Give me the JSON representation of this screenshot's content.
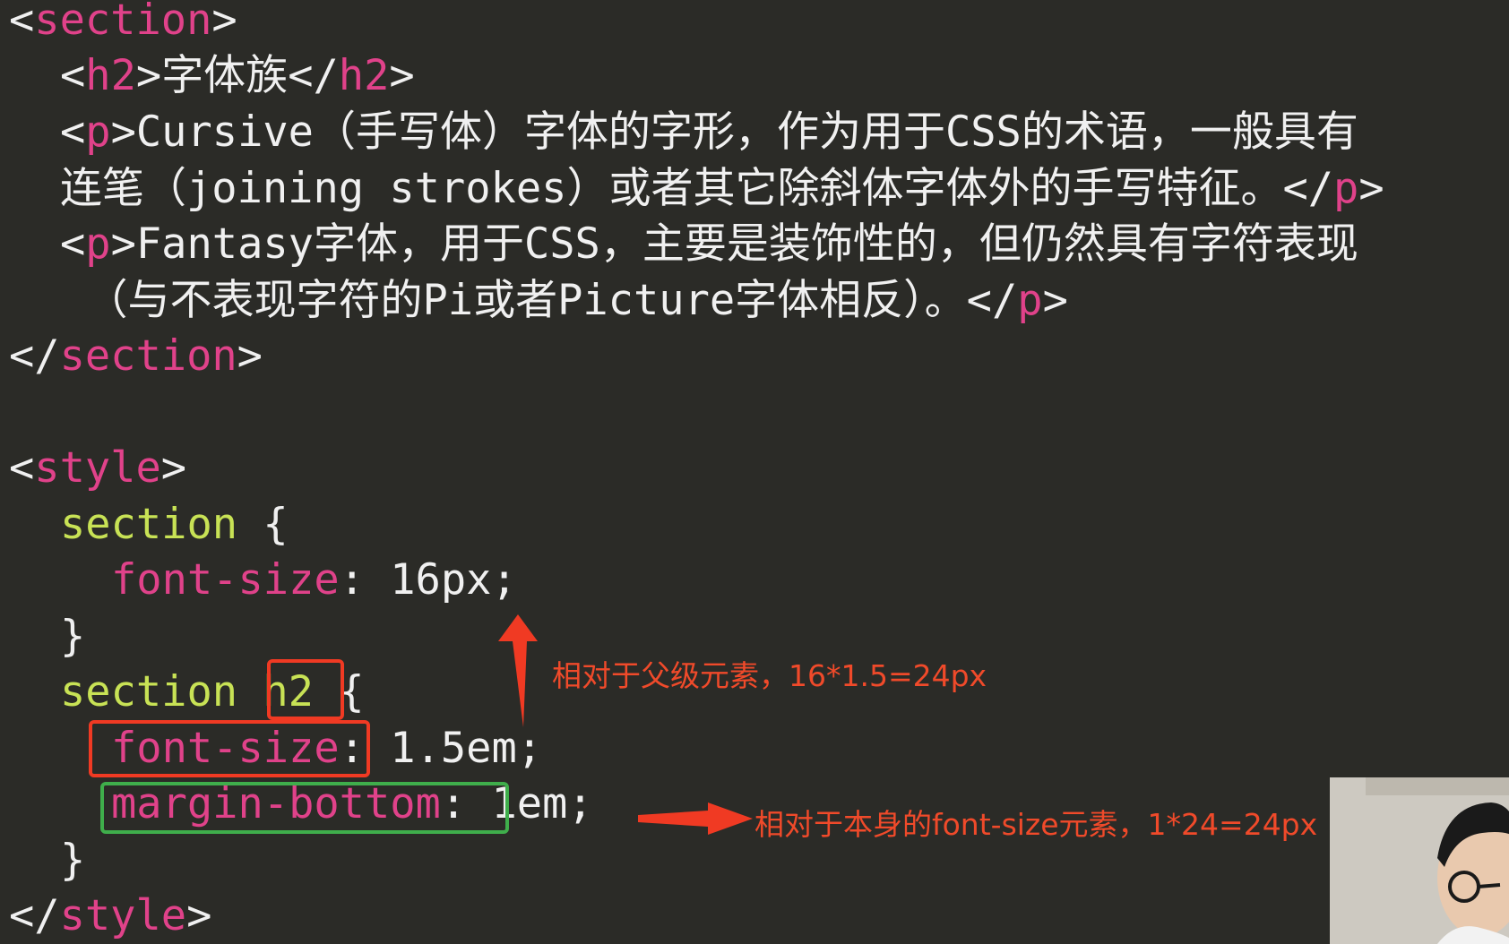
{
  "code_lines": [
    {
      "indent": "",
      "parts": [
        [
          "bracket",
          "<"
        ],
        [
          "tag",
          "section"
        ],
        [
          "bracket",
          ">"
        ]
      ]
    },
    {
      "indent": "  ",
      "parts": [
        [
          "bracket",
          "<"
        ],
        [
          "tag",
          "h2"
        ],
        [
          "bracket",
          ">"
        ],
        [
          "txt",
          "字体族"
        ],
        [
          "bracket",
          "</"
        ],
        [
          "tag",
          "h2"
        ],
        [
          "bracket",
          ">"
        ]
      ]
    },
    {
      "indent": "  ",
      "parts": [
        [
          "bracket",
          "<"
        ],
        [
          "tag",
          "p"
        ],
        [
          "bracket",
          ">"
        ],
        [
          "txt",
          "Cursive（手写体）字体的字形，作为用于CSS的术语，一般具有"
        ]
      ]
    },
    {
      "indent": "  ",
      "parts": [
        [
          "txt",
          "连笔（joining strokes）或者其它除斜体字体外的手写特征。"
        ],
        [
          "bracket",
          "</"
        ],
        [
          "tag",
          "p"
        ],
        [
          "bracket",
          ">"
        ]
      ]
    },
    {
      "indent": "  ",
      "parts": [
        [
          "bracket",
          "<"
        ],
        [
          "tag",
          "p"
        ],
        [
          "bracket",
          ">"
        ],
        [
          "txt",
          "Fantasy字体，用于CSS，主要是装饰性的，但仍然具有字符表现"
        ]
      ]
    },
    {
      "indent": "   ",
      "parts": [
        [
          "txt",
          "（与不表现字符的Pi或者Picture字体相反）。"
        ],
        [
          "bracket",
          "</"
        ],
        [
          "tag",
          "p"
        ],
        [
          "bracket",
          ">"
        ]
      ]
    },
    {
      "indent": "",
      "parts": [
        [
          "bracket",
          "</"
        ],
        [
          "tag",
          "section"
        ],
        [
          "bracket",
          ">"
        ]
      ]
    },
    {
      "indent": "",
      "parts": []
    },
    {
      "indent": "",
      "parts": [
        [
          "bracket",
          "<"
        ],
        [
          "tag",
          "style"
        ],
        [
          "bracket",
          ">"
        ]
      ]
    },
    {
      "indent": "  ",
      "parts": [
        [
          "sel",
          "section"
        ],
        [
          "bracket",
          " {"
        ]
      ]
    },
    {
      "indent": "    ",
      "parts": [
        [
          "prop",
          "font-size"
        ],
        [
          "val",
          ": 16px;"
        ]
      ]
    },
    {
      "indent": "  ",
      "parts": [
        [
          "bracket",
          "}"
        ]
      ]
    },
    {
      "indent": "  ",
      "parts": [
        [
          "sel",
          "section h2"
        ],
        [
          "bracket",
          " {"
        ]
      ]
    },
    {
      "indent": "    ",
      "parts": [
        [
          "prop",
          "font-size"
        ],
        [
          "val",
          ": 1.5em;"
        ]
      ]
    },
    {
      "indent": "    ",
      "parts": [
        [
          "prop",
          "margin-bottom"
        ],
        [
          "val",
          ": 1em;"
        ]
      ]
    },
    {
      "indent": "  ",
      "parts": [
        [
          "bracket",
          "}"
        ]
      ]
    },
    {
      "indent": "",
      "parts": [
        [
          "bracket",
          "</"
        ],
        [
          "tag",
          "style"
        ],
        [
          "bracket",
          ">"
        ]
      ]
    }
  ],
  "annotations": {
    "note_em_parent": "相对于父级元素，16*1.5=24px",
    "note_em_self": "相对于本身的font-size元素，1*24=24px"
  },
  "colors": {
    "background": "#2b2b27",
    "tag": "#e0428a",
    "selector": "#c8e255",
    "property": "#e0428a",
    "text": "#f0f0f0",
    "annotation_red": "#f04a2a",
    "box_red": "#f03a23",
    "box_green": "#3fae4b"
  },
  "webcam": {
    "icon": "presenter-webcam-thumbnail"
  }
}
